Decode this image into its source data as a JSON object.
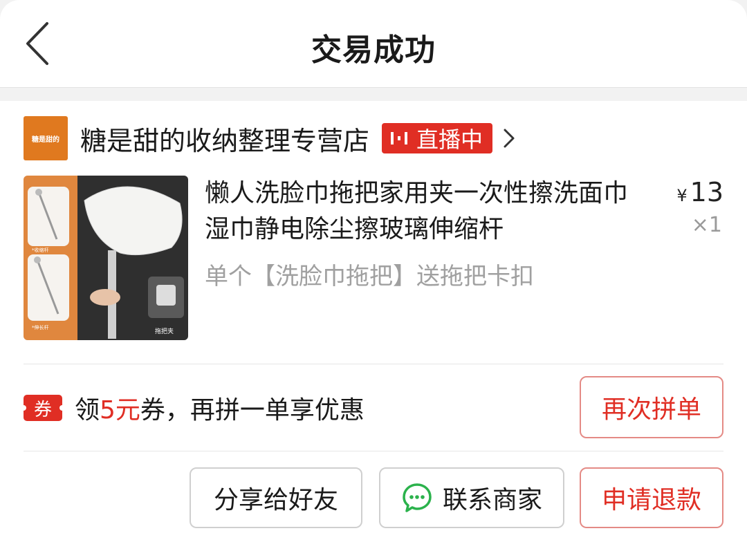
{
  "header": {
    "title": "交易成功"
  },
  "shop": {
    "logo_text": "糖是甜的",
    "name": "糖是甜的收纳整理专营店",
    "live_label": "直播中"
  },
  "product": {
    "title": "懒人洗脸巾拖把家用夹一次性擦洗面巾湿巾静电除尘擦玻璃伸缩杆",
    "spec": "单个【洗脸巾拖把】送拖把卡扣",
    "currency": "¥",
    "price": "13",
    "quantity": "×1",
    "image_labels": [
      "*收缩杆",
      "*伸长杆",
      "拖把夹"
    ]
  },
  "coupon": {
    "tag": "券",
    "text_before": "领",
    "amount": "5元",
    "text_after": "券，再拼一单享优惠",
    "button": "再次拼单"
  },
  "actions": {
    "share": "分享给好友",
    "contact": "联系商家",
    "refund": "申请退款"
  },
  "colors": {
    "accent": "#e02e24",
    "logo": "#e0791f",
    "chat_icon": "#2bb24c"
  }
}
